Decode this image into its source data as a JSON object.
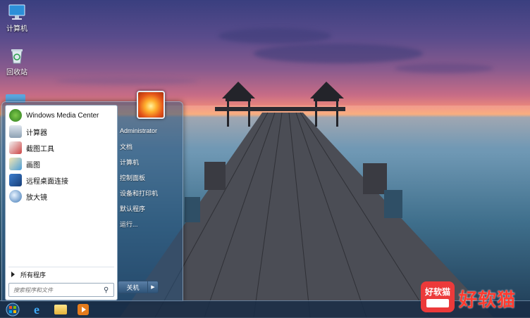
{
  "desktop": {
    "icons": [
      {
        "label": "计算机",
        "icon": "computer-icon"
      },
      {
        "label": "回收站",
        "icon": "recycle-bin-icon"
      }
    ]
  },
  "start_menu": {
    "programs": [
      {
        "label": "Windows Media Center",
        "icon": "media-center-icon"
      },
      {
        "label": "计算器",
        "icon": "calculator-icon"
      },
      {
        "label": "截图工具",
        "icon": "snipping-tool-icon"
      },
      {
        "label": "画图",
        "icon": "paint-icon"
      },
      {
        "label": "远程桌面连接",
        "icon": "remote-desktop-icon"
      },
      {
        "label": "放大镜",
        "icon": "magnifier-icon"
      }
    ],
    "all_programs": "所有程序",
    "search_placeholder": "搜索程序和文件",
    "user": "Administrator",
    "right_items": [
      "文档",
      "计算机",
      "控制面板",
      "设备和打印机",
      "默认程序",
      "运行..."
    ],
    "shutdown_label": "关机"
  },
  "taskbar": {
    "items": [
      "start-orb-icon",
      "internet-explorer-icon",
      "file-explorer-icon",
      "media-player-icon"
    ]
  },
  "watermark": {
    "badge_text": "好软猫",
    "text": "好软猫"
  },
  "colors": {
    "accent": "#2f5479",
    "watermark_red": "#ec3a3a"
  }
}
